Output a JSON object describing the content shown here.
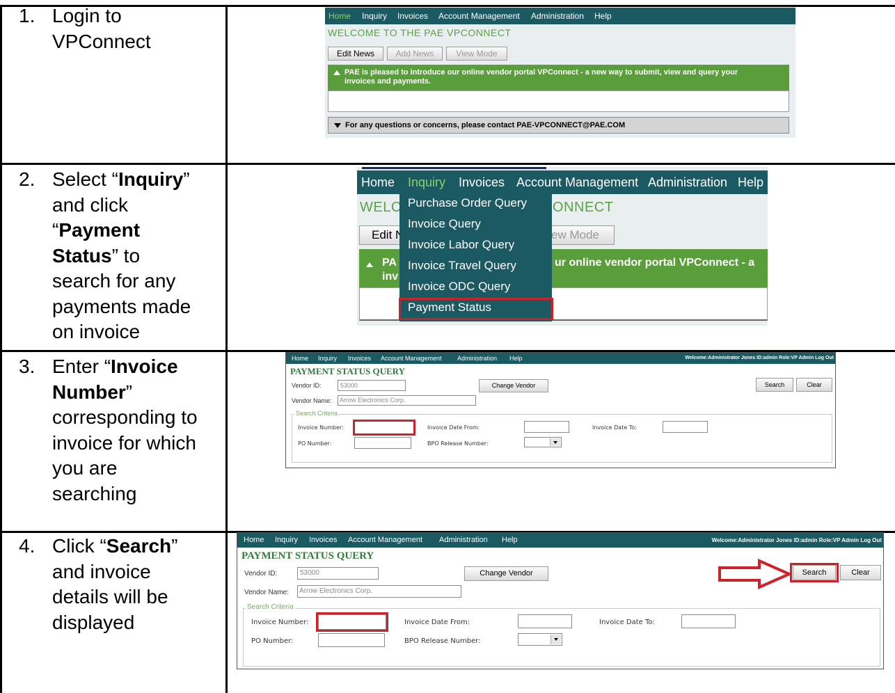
{
  "steps": [
    {
      "num": "1.",
      "lines": [
        "Login to",
        "VPConnect"
      ]
    },
    {
      "num": "2.",
      "pre1": "Select “",
      "b1": "Inquiry",
      "post1": "”",
      "line2": "and click",
      "pre3": "“",
      "b3": "Payment",
      "b4": "Status",
      "post4": "” to",
      "rest": [
        "search for any",
        "payments made",
        "on invoice"
      ]
    },
    {
      "num": "3.",
      "pre1": "Enter “",
      "b1": "Invoice",
      "b2": "Number",
      "post2": "”",
      "rest": [
        "corresponding to",
        "invoice for which",
        "you are",
        "searching"
      ]
    },
    {
      "num": "4.",
      "pre1": "Click “",
      "b1": "Search",
      "post1": "”",
      "rest": [
        "and invoice",
        "details will be",
        "displayed"
      ]
    }
  ],
  "nav": {
    "home": "Home",
    "inquiry": "Inquiry",
    "invoices": "Invoices",
    "account_management": "Account Management",
    "administration": "Administration",
    "help": "Help"
  },
  "welcome": {
    "title": "WELCOME TO THE PAE VPCONNECT",
    "title_partial_left": "WELC",
    "title_partial_right": "ONNECT",
    "buttons": {
      "edit_news": "Edit News",
      "add_news": "Add News",
      "view_mode": "View Mode",
      "edit_partial": "Edit N",
      "view_partial": "ew Mode"
    },
    "news_line1": "PAE is pleased to introduce our online vendor portal VPConnect - a new way to submit, view and query your",
    "news_line2": "invoices and payments.",
    "news_partial_a": "PA",
    "news_partial_b": "inv",
    "news_partial_right": "ur online vendor portal VPConnect - a",
    "contact": "For any questions or concerns, please contact PAE-VPCONNECT@PAE.COM"
  },
  "inquiry_menu": [
    "Purchase Order Query",
    "Invoice Query",
    "Invoice Labor Query",
    "Invoice Travel Query",
    "Invoice ODC Query",
    "Payment Status"
  ],
  "query": {
    "title": "PAYMENT STATUS QUERY",
    "user_info": "Welcome:Administrator Jones  ID:admin  Role:VP Admin  Log Out",
    "vendor_id_label": "Vendor ID:",
    "vendor_id_value": "53000",
    "change_vendor": "Change Vendor",
    "vendor_name_label": "Vendor Name:",
    "vendor_name_value": "Arrow Electronics Corp.",
    "search": "Search",
    "clear": "Clear",
    "criteria": "Search Criteria",
    "invoice_number": "Invoice Number:",
    "invoice_date_from": "Invoice Date From:",
    "invoice_date_to": "Invoice Date To:",
    "po_number": "PO Number:",
    "bpo_release": "BPO Release Number:"
  },
  "colors": {
    "nav_bg": "#1c5a63",
    "accent_green": "#5a9e3c",
    "highlight_red": "#d0202a"
  }
}
